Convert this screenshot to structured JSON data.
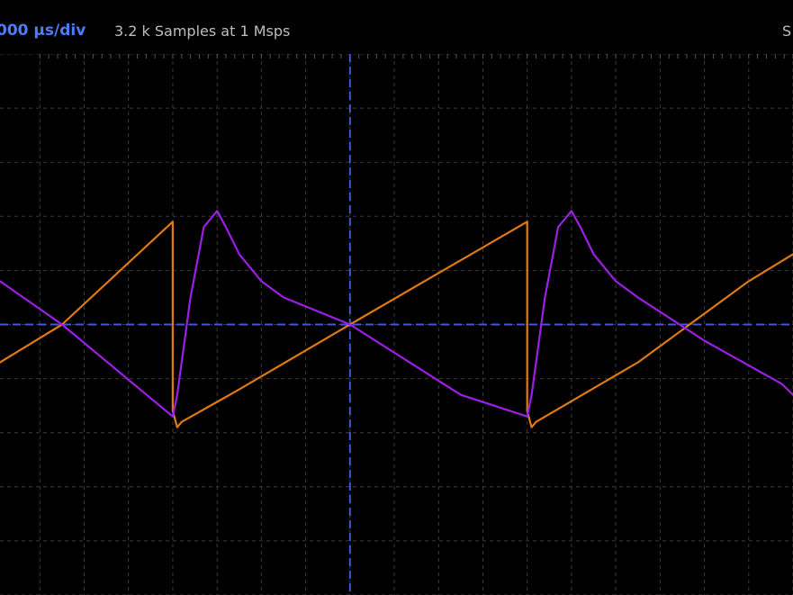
{
  "header": {
    "timebase": "000 µs/div",
    "samples": "3.2 k Samples at 1 Msps",
    "right_label": "S"
  },
  "chart_data": {
    "type": "line",
    "title": "",
    "xlabel": "",
    "ylabel": "",
    "xlim": [
      -1.58,
      2.0
    ],
    "ylim": [
      -5,
      5
    ],
    "grid": true,
    "x_grid_step": 0.2,
    "y_grid_step": 1,
    "center_markers": {
      "x": 0,
      "y": 0
    },
    "colors": {
      "grid": "#3a3a3a",
      "marker": "#3f58d6",
      "orange": "#e07a10",
      "purple": "#9b1fe6"
    },
    "series": [
      {
        "color": "#e07a10",
        "x": [
          -1.58,
          -1.3,
          -0.8,
          -0.8,
          -0.78,
          -0.76,
          -0.5,
          0,
          0.8,
          0.8,
          0.82,
          0.84,
          1.3,
          1.8,
          2.0
        ],
        "y": [
          -0.7,
          0,
          1.9,
          -1.6,
          -1.9,
          -1.8,
          -1.2,
          0,
          1.9,
          -1.6,
          -1.9,
          -1.8,
          -0.7,
          0.8,
          1.3
        ]
      },
      {
        "color": "#9b1fe6",
        "x": [
          -1.58,
          -1.3,
          -0.8,
          -0.78,
          -0.72,
          -0.66,
          -0.6,
          -0.56,
          -0.5,
          -0.4,
          -0.3,
          0,
          0.5,
          0.8,
          0.82,
          0.88,
          0.94,
          1.0,
          1.04,
          1.1,
          1.2,
          1.3,
          1.6,
          1.95,
          2.0
        ],
        "y": [
          0.8,
          0,
          -1.7,
          -1.3,
          0.5,
          1.8,
          2.1,
          1.8,
          1.3,
          0.8,
          0.5,
          0,
          -1.3,
          -1.7,
          -1.3,
          0.5,
          1.8,
          2.1,
          1.8,
          1.3,
          0.8,
          0.5,
          -0.3,
          -1.1,
          -1.3
        ]
      }
    ]
  }
}
